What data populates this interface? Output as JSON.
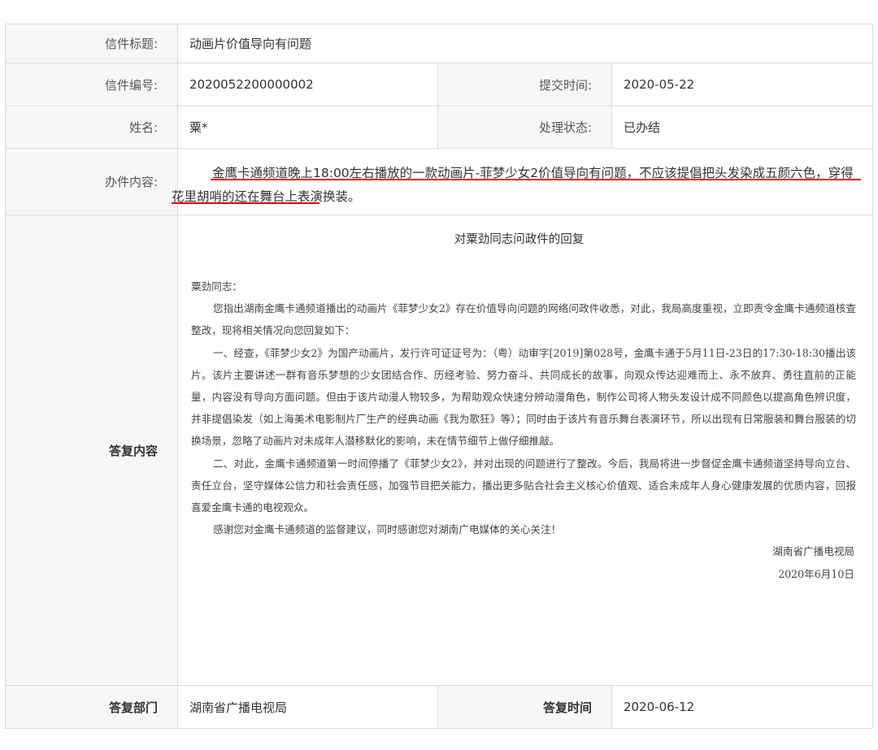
{
  "letter": {
    "title_label": "信件标题:",
    "title_value": "动画片价值导向有问题",
    "number_label": "信件编号:",
    "number_value": "2020052200000002",
    "submit_time_label": "提交时间:",
    "submit_time_value": "2020-05-22",
    "name_label": "姓名:",
    "name_value": "粟*",
    "status_label": "处理状态:",
    "status_value": "已办结",
    "content_label": "办件内容:",
    "content_value": "金鹰卡通频道晚上18:00左右播放的一款动画片-菲梦少女2价值导向有问题，不应该提倡把头发染成五颜六色，穿得花里胡哨的还在舞台上表演换装。",
    "underline_color": "#e60012"
  },
  "reply": {
    "label": "答复内容",
    "title": "对粟劲同志问政件的回复",
    "salutation": "粟劲同志：",
    "paragraphs": [
      "您指出湖南金鹰卡通频道播出的动画片《菲梦少女2》存在价值导向问题的网络问政件收悉，对此，我局高度重视，立即责令金鹰卡通频道核查整改，现将相关情况向您回复如下：",
      "一、经查，《菲梦少女2》为国产动画片，发行许可证证号为：（粤）动审字[2019]第028号，金鹰卡通于5月11日-23日的17:30-18:30播出该片。该片主要讲述一群有音乐梦想的少女团结合作、历经考验、努力奋斗、共同成长的故事，向观众传达迎难而上、永不放弃、勇往直前的正能量，内容没有导向方面问题。但由于该片动漫人物较多，为帮助观众快速分辨动漫角色，制作公司将人物头发设计成不同颜色以提高角色辨识度，并非提倡染发（如上海美术电影制片厂生产的经典动画《我为歌狂》等）；同时由于该片有音乐舞台表演环节，所以出现有日常服装和舞台服装的切换场景，忽略了动画片对未成年人潜移默化的影响，未在情节细节上做仔细推敲。",
      "二、对此，金鹰卡通频道第一时间停播了《菲梦少女2》，并对出现的问题进行了整改。今后，我局将进一步督促金鹰卡通频道坚持导向立台、责任立台，坚守媒体公信力和社会责任感，加强节目把关能力，播出更多贴合社会主义核心价值观、适合未成年人身心健康发展的优质内容，回报喜爱金鹰卡通的电视观众。",
      "感谢您对金鹰卡通频道的监督建议，同时感谢您对湖南广电媒体的关心关注！"
    ],
    "signature_org": "湖南省广播电视局",
    "signature_date": "2020年6月10日",
    "dept_label": "答复部门",
    "dept_value": "湖南省广播电视局",
    "time_label": "答复时间",
    "time_value": "2020-06-12"
  }
}
